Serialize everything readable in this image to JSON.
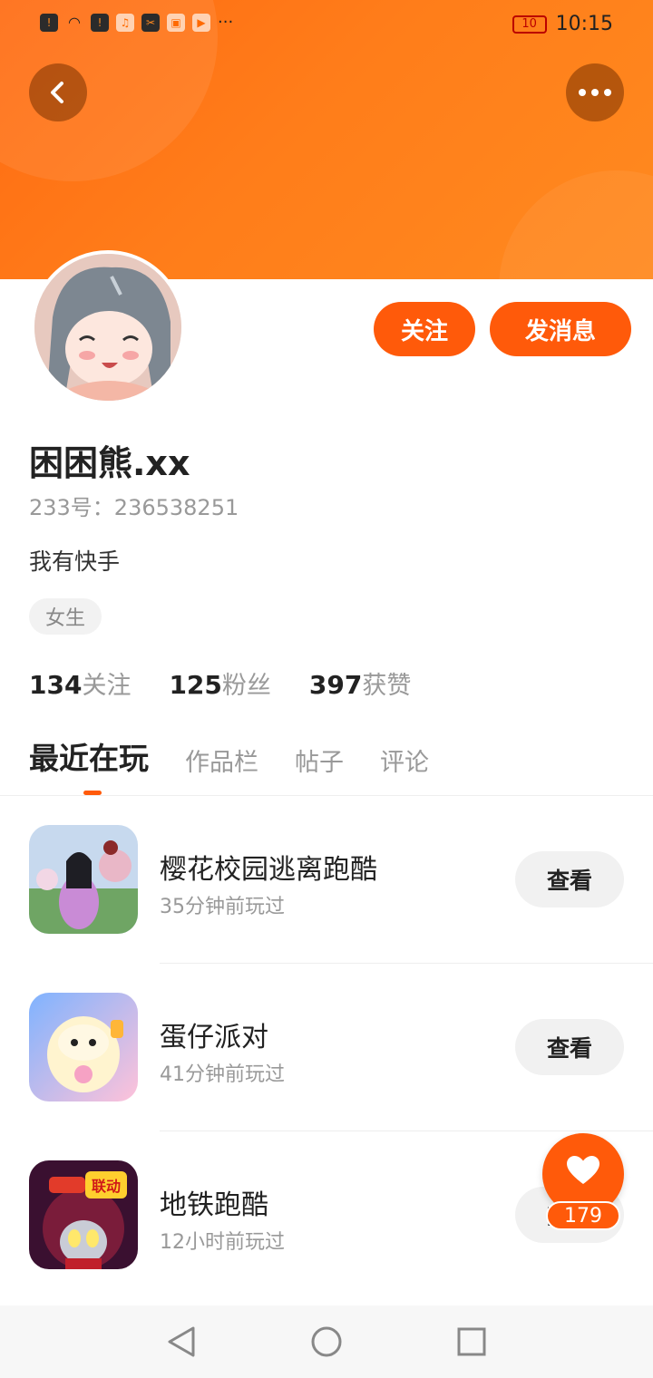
{
  "status_bar": {
    "time": "10:15",
    "battery": "10",
    "more": "···"
  },
  "header": {
    "accent_color": "#ff6b12",
    "back_icon": "chevron-left-icon",
    "more_icon": "more-dots-icon"
  },
  "actions": {
    "follow_label": "关注",
    "message_label": "发消息"
  },
  "profile": {
    "username": "困困熊.xx",
    "id_text": "233号：236538251",
    "bio": "我有快手",
    "gender_tag": "女生"
  },
  "stats": [
    {
      "value": "134",
      "label": "关注"
    },
    {
      "value": "125",
      "label": "粉丝"
    },
    {
      "value": "397",
      "label": "获赞"
    }
  ],
  "tabs": [
    "最近在玩",
    "作品栏",
    "帖子",
    "评论"
  ],
  "games": [
    {
      "name": "樱花校园逃离跑酷",
      "time": "35分钟前玩过",
      "button": "查看"
    },
    {
      "name": "蛋仔派对",
      "time": "41分钟前玩过",
      "button": "查看"
    },
    {
      "name": "地铁跑酷",
      "time": "12小时前玩过",
      "button": "查看"
    }
  ],
  "game_icon_badge": "联动",
  "fab": {
    "icon": "heart-icon",
    "count": "179"
  }
}
